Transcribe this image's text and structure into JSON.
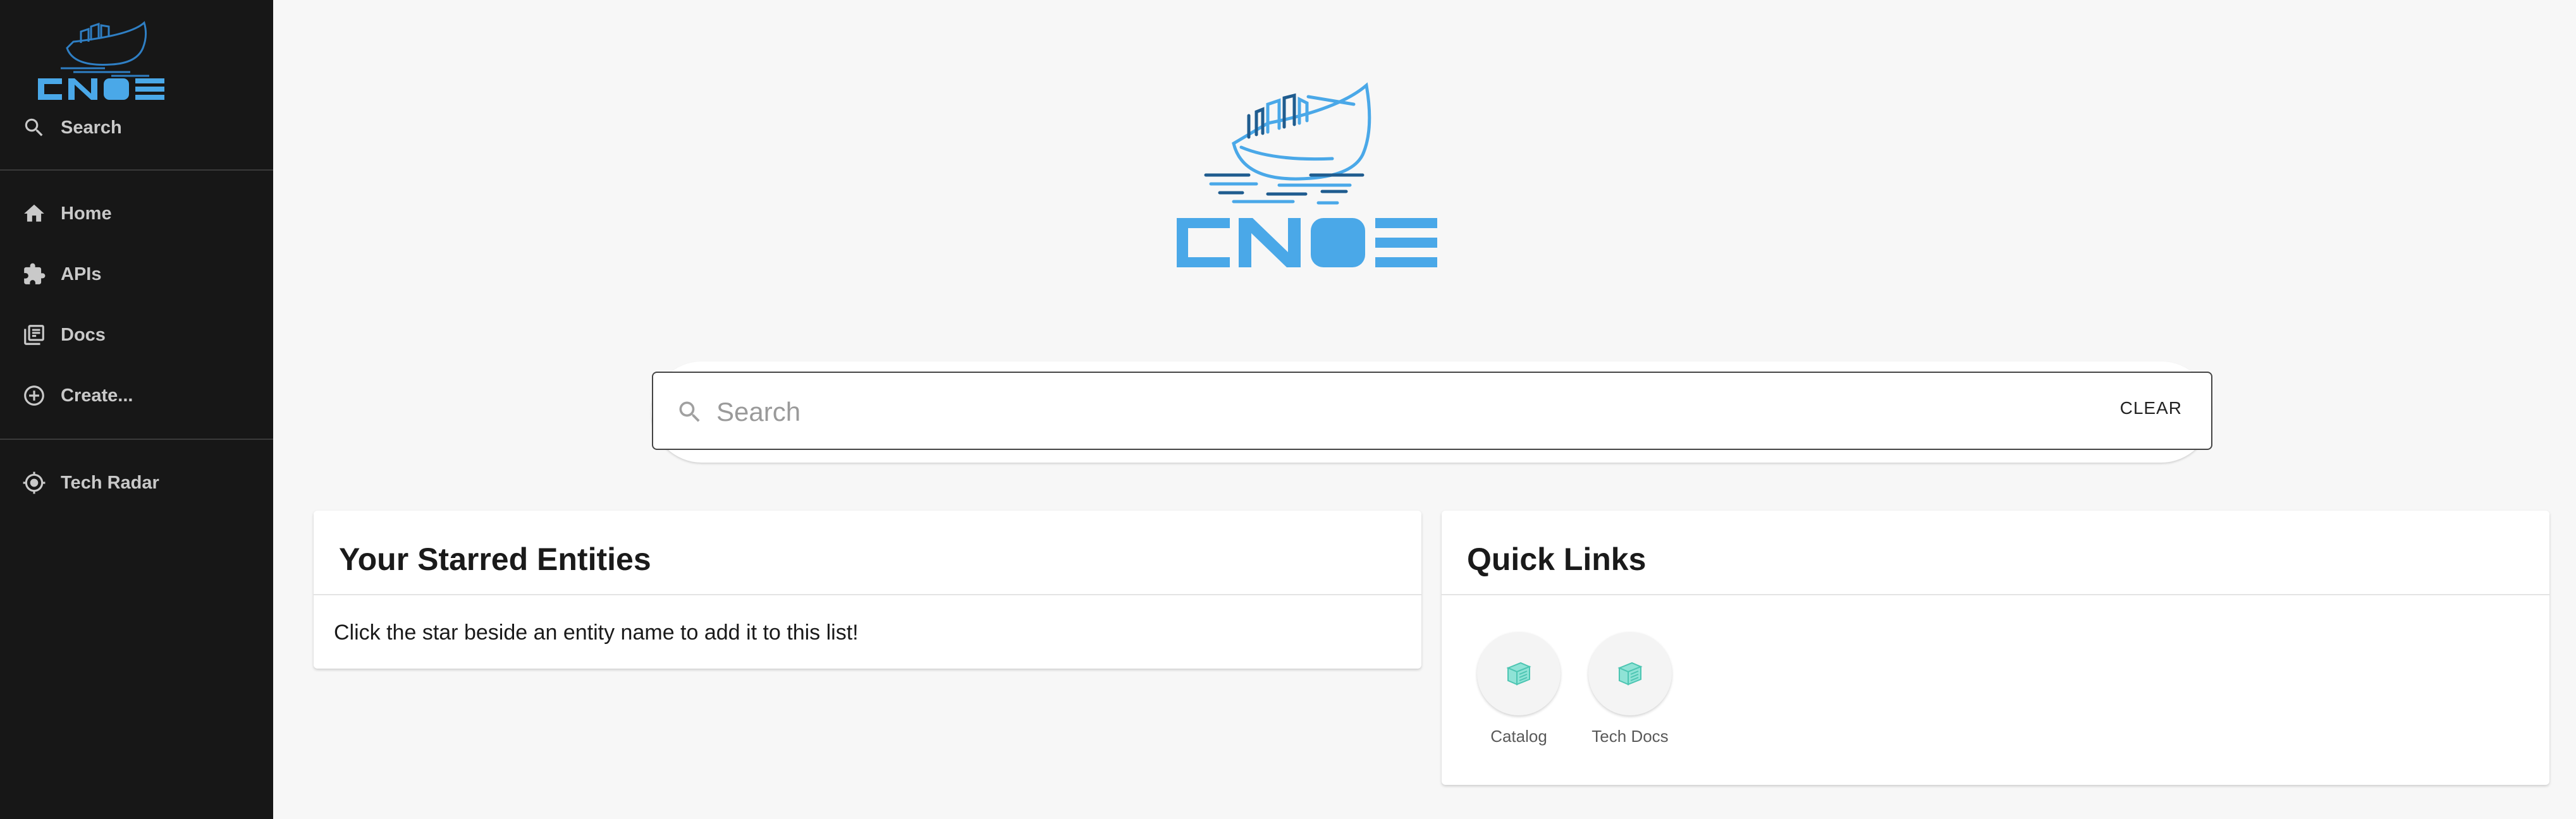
{
  "brand": {
    "name": "CNOE",
    "primary_color": "#4aa8e8",
    "dark_color": "#1f5c8f"
  },
  "sidebar": {
    "search_label": "Search",
    "items": [
      {
        "label": "Home",
        "icon": "home-icon"
      },
      {
        "label": "APIs",
        "icon": "puzzle-icon"
      },
      {
        "label": "Docs",
        "icon": "library-books-icon"
      },
      {
        "label": "Create...",
        "icon": "add-circle-icon"
      },
      {
        "label": "Tech Radar",
        "icon": "radar-icon"
      }
    ]
  },
  "search": {
    "placeholder": "Search",
    "value": "",
    "clear_label": "CLEAR"
  },
  "starred": {
    "title": "Your Starred Entities",
    "empty_text": "Click the star beside an entity name to add it to this list!"
  },
  "quick_links": {
    "title": "Quick Links",
    "links": [
      {
        "label": "Catalog",
        "icon": "catalog-icon"
      },
      {
        "label": "Tech Docs",
        "icon": "tech-docs-icon"
      }
    ]
  }
}
